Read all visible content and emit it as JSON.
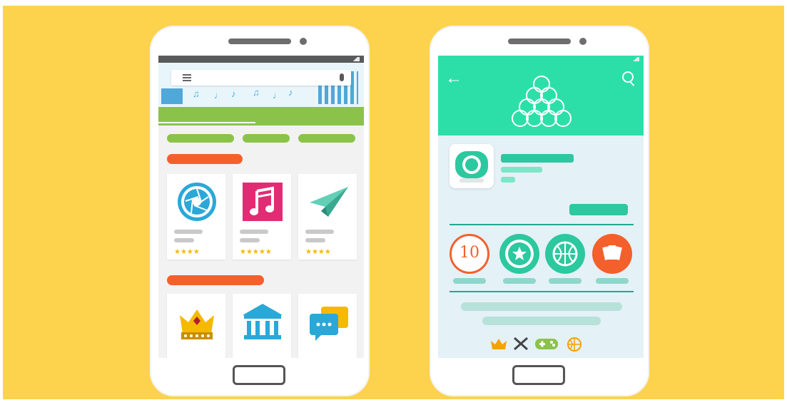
{
  "left_phone": {
    "stores_cards_row1": [
      {
        "icon": "camera-aperture-icon",
        "stars": "★★★★"
      },
      {
        "icon": "music-note-icon",
        "stars": "★★★★★"
      },
      {
        "icon": "paper-plane-icon",
        "stars": "★★★★"
      }
    ],
    "stores_cards_row2": [
      {
        "icon": "crown-icon"
      },
      {
        "icon": "bank-building-icon"
      },
      {
        "icon": "chat-bubbles-icon"
      }
    ]
  },
  "right_phone": {
    "badges": [
      {
        "icon": "ten-badge-icon",
        "text": "10"
      },
      {
        "icon": "star-badge-icon"
      },
      {
        "icon": "basketball-badge-icon"
      },
      {
        "icon": "cards-badge-icon"
      }
    ],
    "bottom_icons": [
      "crown-icon",
      "crossed-swords-icon",
      "gamepad-icon",
      "ball-icon"
    ]
  },
  "colors": {
    "background": "#fdd34e",
    "teal": "#2cdfa9",
    "green": "#8bc34a",
    "orange": "#f4602c"
  }
}
